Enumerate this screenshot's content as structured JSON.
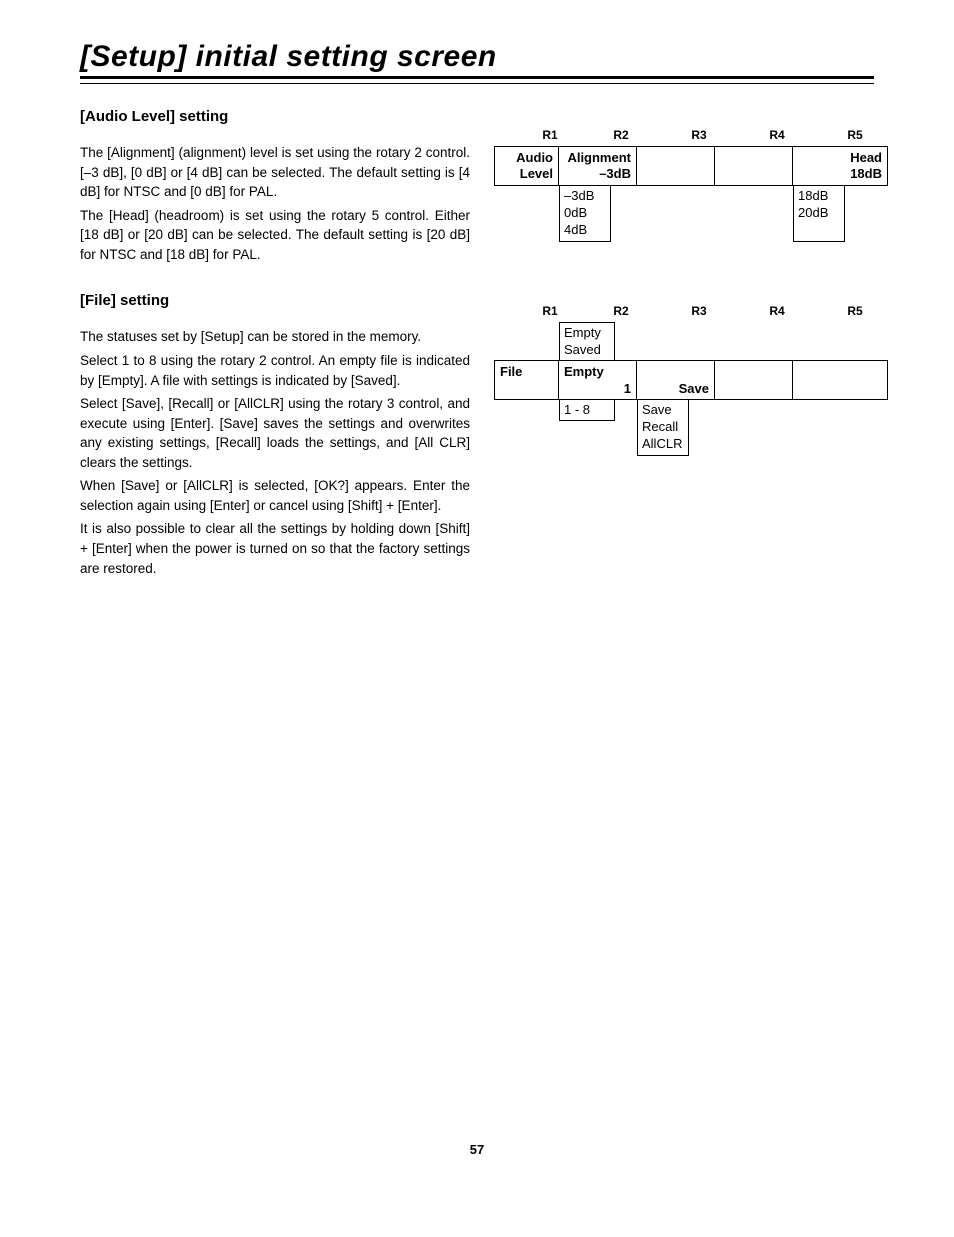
{
  "title": "[Setup] initial setting screen",
  "audio": {
    "heading": "[Audio Level] setting",
    "para1": "The [Alignment] (alignment) level is set using the rotary 2 control.  [–3 dB], [0 dB] or [4 dB] can be selected.  The default setting is [4 dB] for NTSC and [0 dB] for PAL.",
    "para2": "The [Head] (headroom) is set using the rotary 5 control.  Either [18 dB] or [20 dB] can be selected.  The default setting is [20 dB] for NTSC and [18 dB] for PAL.",
    "rotary_labels": [
      "R1",
      "R2",
      "R3",
      "R4",
      "R5"
    ],
    "row": {
      "c1a": "Audio",
      "c1b": "Level",
      "c2a": "Alignment",
      "c2b": "–3dB",
      "c5a": "Head",
      "c5b": "18dB"
    },
    "options_r2": [
      "–3dB",
      "0dB",
      "4dB"
    ],
    "options_r5": [
      "18dB",
      "20dB"
    ]
  },
  "file": {
    "heading": "[File] setting",
    "para1": "The statuses set by [Setup] can be stored in the memory.",
    "para2": "Select 1 to 8 using the rotary 2 control.  An empty file is indicated by [Empty].  A file with settings is indicated by [Saved].",
    "para3": "Select [Save], [Recall] or [AllCLR] using the rotary 3 control, and execute using [Enter].  [Save] saves the settings and overwrites any existing settings, [Recall] loads the settings, and [All CLR] clears the settings.",
    "para4": "When [Save] or [AllCLR] is selected, [OK?] appears.  Enter the selection again using [Enter] or cancel using [Shift] + [Enter].",
    "para5": "It is also possible to clear all the settings by holding down [Shift] + [Enter] when the power is turned on so that the factory settings are restored.",
    "rotary_labels": [
      "R1",
      "R2",
      "R3",
      "R4",
      "R5"
    ],
    "pre_options_r2": [
      "Empty",
      "Saved"
    ],
    "row": {
      "c1": "File",
      "c2a": "Empty",
      "c2b": "1",
      "c3": "Save"
    },
    "options_r2": [
      "1 - 8"
    ],
    "options_r3": [
      "Save",
      "Recall",
      "AllCLR"
    ]
  },
  "page_number": "57"
}
